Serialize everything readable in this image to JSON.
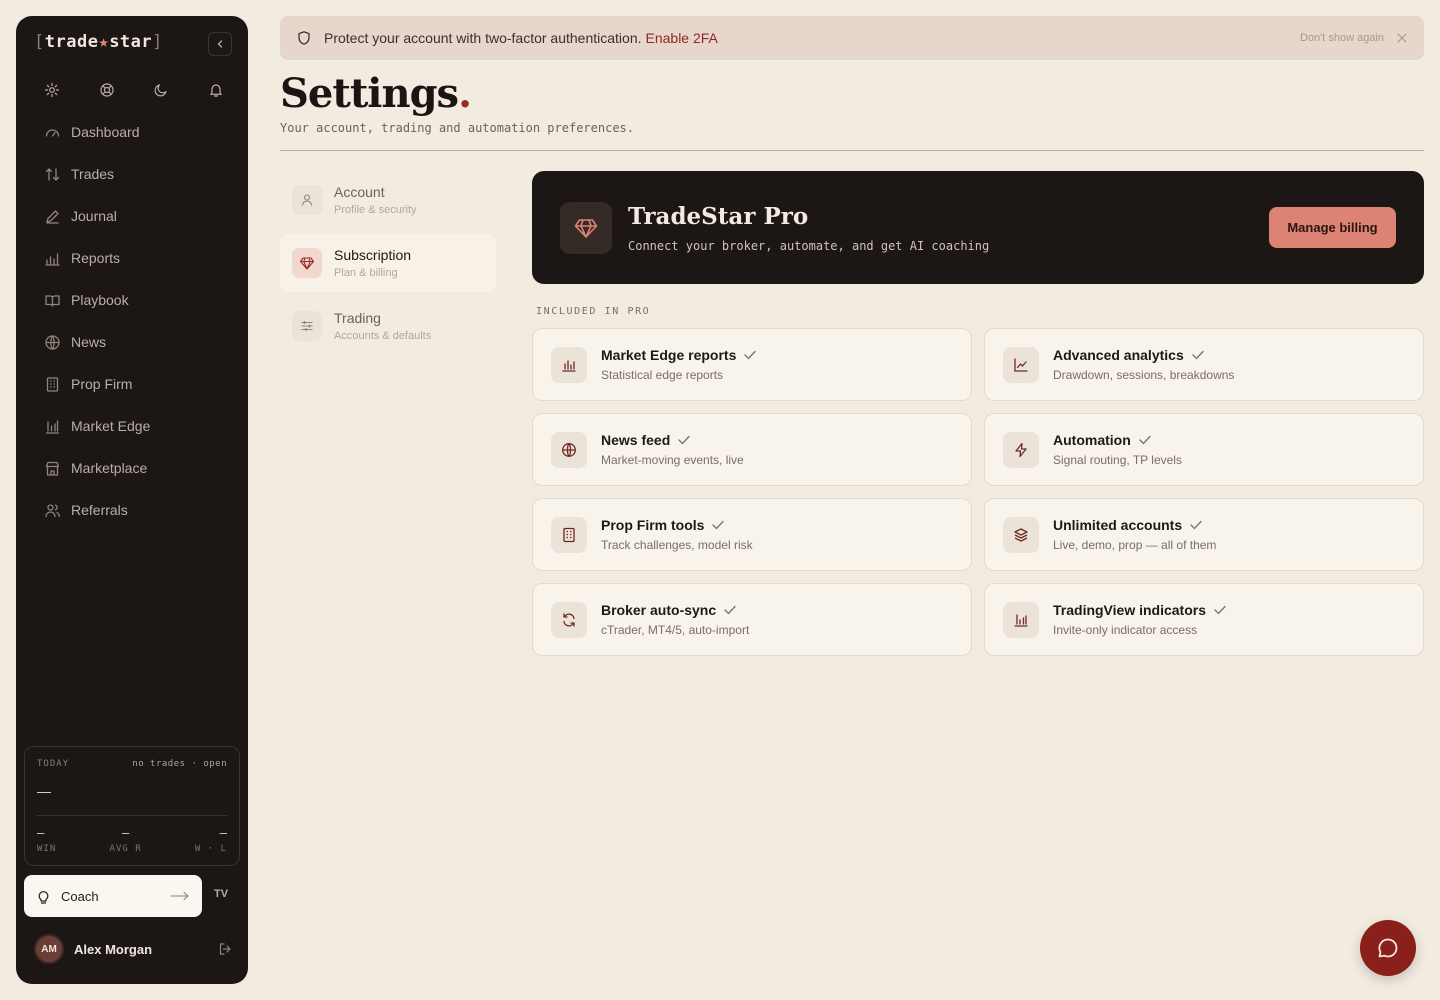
{
  "sidebar": {
    "logo": {
      "open": "[",
      "part1": "trade",
      "star": "★",
      "part2": "star",
      "close": "]"
    },
    "nav": [
      {
        "label": "Dashboard",
        "icon": "gauge-icon"
      },
      {
        "label": "Trades",
        "icon": "arrows-updown-icon"
      },
      {
        "label": "Journal",
        "icon": "pen-icon"
      },
      {
        "label": "Reports",
        "icon": "bar-chart-icon"
      },
      {
        "label": "Playbook",
        "icon": "book-icon"
      },
      {
        "label": "News",
        "icon": "globe-icon"
      },
      {
        "label": "Prop Firm",
        "icon": "building-icon"
      },
      {
        "label": "Market Edge",
        "icon": "bars-icon"
      },
      {
        "label": "Marketplace",
        "icon": "store-icon"
      },
      {
        "label": "Referrals",
        "icon": "users-icon"
      }
    ],
    "today": {
      "label": "TODAY",
      "status": "no trades · open",
      "pnl": "—",
      "win_value": "—",
      "win_label": "WIN",
      "avgr_value": "—",
      "avgr_label": "AVG R",
      "wl_value": "—",
      "wl_label": "W · L"
    },
    "coach_label": "Coach",
    "tv_badge": "TV",
    "user": {
      "initials": "AM",
      "name": "Alex Morgan"
    }
  },
  "banner": {
    "message": "Protect your account with two-factor authentication.",
    "link": "Enable 2FA",
    "dismiss": "Don't show again"
  },
  "page": {
    "title": "Settings",
    "title_dot": ".",
    "subtitle": "Your account, trading and automation preferences."
  },
  "tabs": [
    {
      "label": "Account",
      "sub": "Profile & security"
    },
    {
      "label": "Subscription",
      "sub": "Plan & billing",
      "active": true
    },
    {
      "label": "Trading",
      "sub": "Accounts & defaults"
    }
  ],
  "pro": {
    "title": "TradeStar Pro",
    "subtitle": "Connect your broker, automate, and get AI coaching",
    "button": "Manage billing"
  },
  "section_label": "INCLUDED IN PRO",
  "features": [
    {
      "title": "Market Edge reports",
      "sub": "Statistical edge reports",
      "icon": "bar-chart-icon"
    },
    {
      "title": "Advanced analytics",
      "sub": "Drawdown, sessions, breakdowns",
      "icon": "line-chart-icon"
    },
    {
      "title": "News feed",
      "sub": "Market-moving events, live",
      "icon": "globe-icon"
    },
    {
      "title": "Automation",
      "sub": "Signal routing, TP levels",
      "icon": "lightning-icon"
    },
    {
      "title": "Prop Firm tools",
      "sub": "Track challenges, model risk",
      "icon": "building-icon"
    },
    {
      "title": "Unlimited accounts",
      "sub": "Live, demo, prop — all of them",
      "icon": "layers-icon"
    },
    {
      "title": "Broker auto-sync",
      "sub": "cTrader, MT4/5, auto-import",
      "icon": "sync-icon"
    },
    {
      "title": "TradingView indicators",
      "sub": "Invite-only indicator access",
      "icon": "bars-icon"
    }
  ],
  "colors": {
    "accent": "#dc8373",
    "brand_dark": "#1c1714",
    "danger": "#8a1f1c",
    "background": "#f1ebe0"
  }
}
